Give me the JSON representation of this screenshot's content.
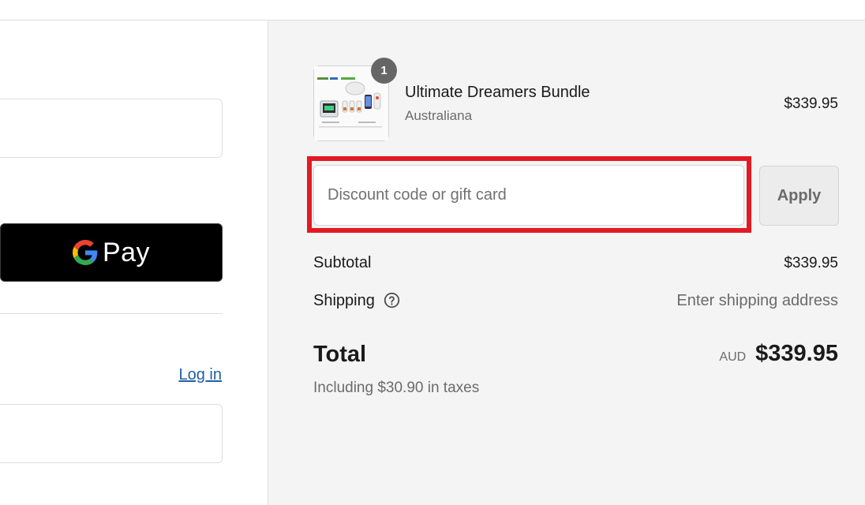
{
  "left_panel": {
    "gpay_label": "Pay",
    "login_label": "Log in"
  },
  "product": {
    "quantity": "1",
    "name": "Ultimate Dreamers Bundle",
    "variant": "Australiana",
    "price": "$339.95"
  },
  "discount": {
    "placeholder": "Discount code or gift card",
    "apply_label": "Apply"
  },
  "summary": {
    "subtotal_label": "Subtotal",
    "subtotal_value": "$339.95",
    "shipping_label": "Shipping",
    "shipping_value": "Enter shipping address",
    "total_label": "Total",
    "currency": "AUD",
    "total_value": "$339.95",
    "taxes_note": "Including $30.90 in taxes"
  },
  "colors": {
    "highlight": "#e31a23",
    "link": "#1f5fa8",
    "summary_bg": "#f4f4f4"
  }
}
